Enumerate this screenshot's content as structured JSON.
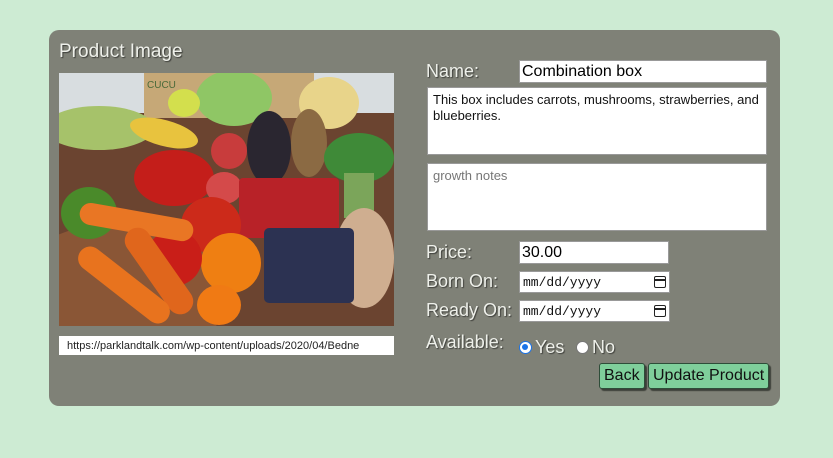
{
  "card": {
    "title": "Product Image"
  },
  "image": {
    "url_value": "https://parklandtalk.com/wp-content/uploads/2020/04/Bedne",
    "box_text": "CUCU"
  },
  "form": {
    "name_label": "Name:",
    "name_value": "Combination box",
    "description_value": "This box includes carrots, mushrooms, strawberries, and blueberries.",
    "growth_notes_placeholder": "growth notes",
    "price_label": "Price:",
    "price_value": "30.00",
    "born_label": "Born On:",
    "born_value": "mm/dd/yyyy",
    "ready_label": "Ready On:",
    "ready_value": "mm/dd/yyyy",
    "available_label": "Available:",
    "yes_label": "Yes",
    "no_label": "No",
    "available_selected": "Yes"
  },
  "buttons": {
    "back": "Back",
    "update": "Update Product"
  },
  "colors": {
    "page_bg": "#cdebd3",
    "card_bg": "#7f8177",
    "button_bg": "#7fcf9b",
    "radio_accent": "#1a73e8"
  },
  "icons": [
    "calendar-icon"
  ]
}
